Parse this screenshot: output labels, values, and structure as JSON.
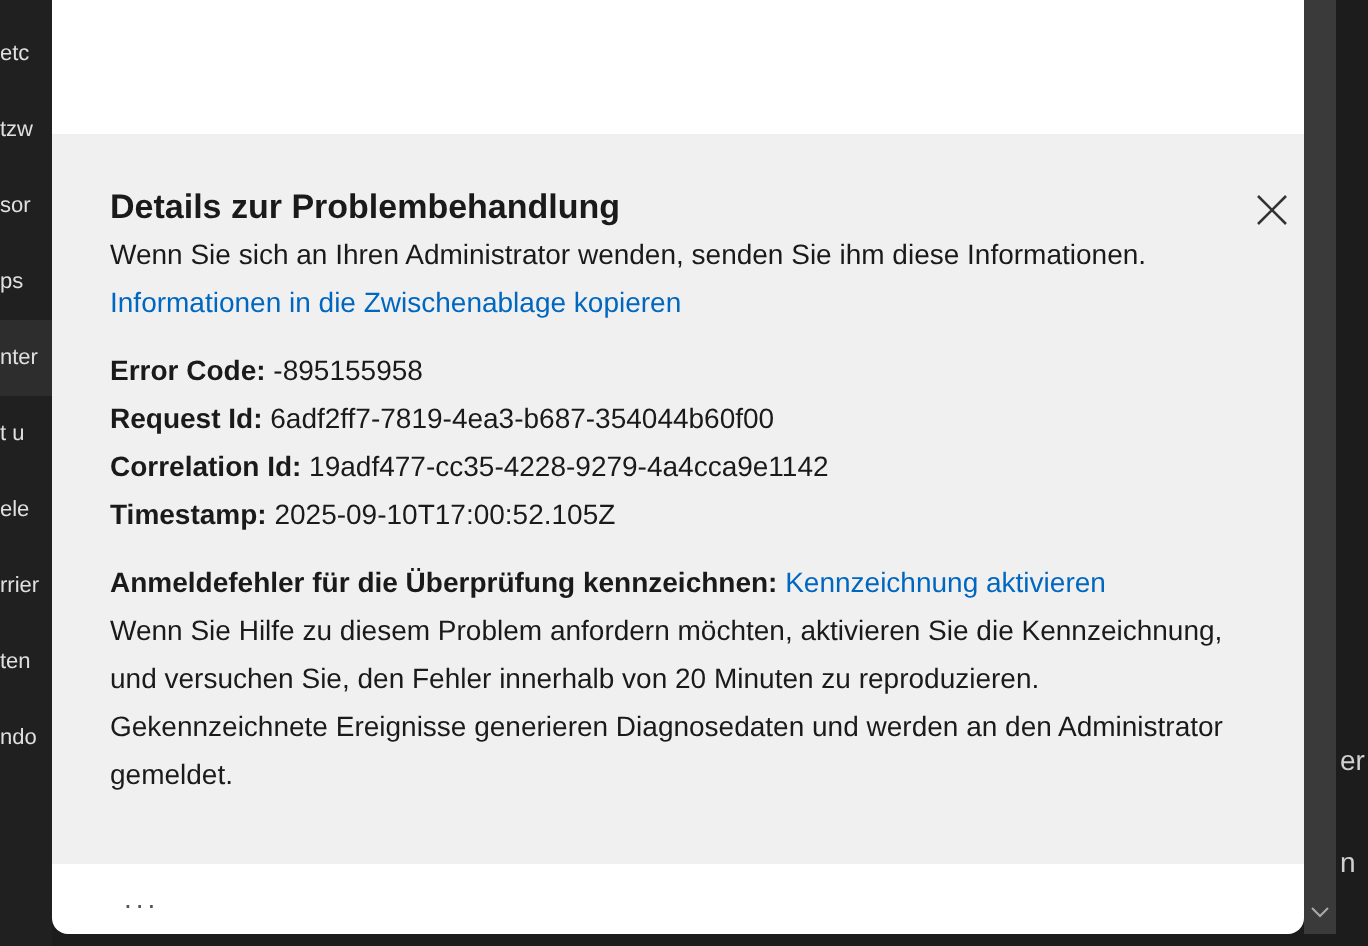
{
  "sidebar": {
    "items": [
      {
        "label": "etc",
        "selected": false
      },
      {
        "label": "tzw",
        "selected": false
      },
      {
        "label": "sor",
        "selected": false
      },
      {
        "label": "ps",
        "selected": false
      },
      {
        "label": "nter",
        "selected": true
      },
      {
        "label": "t u",
        "selected": false
      },
      {
        "label": "ele",
        "selected": false
      },
      {
        "label": "rrier",
        "selected": false
      },
      {
        "label": "ten",
        "selected": false
      },
      {
        "label": "ndo",
        "selected": false
      }
    ]
  },
  "dialog": {
    "title": "Details zur Problembehandlung",
    "subtitle": "Wenn Sie sich an Ihren Administrator wenden, senden Sie ihm diese Informationen.",
    "copy_link": "Informationen in die Zwischenablage kopieren",
    "details": [
      "**Error Code:** -895155958",
      "**Request Id:** 6adf2ff7-7819-4ea3-b687-354044b60f00",
      "**Correlation Id:** 19adf477-cc35-4228-9279-4a4cca9e1142",
      "**Timestamp:** 2025-09-10T17:00:52.105Z"
    ],
    "flag_label": "**Anmeldefehler für die Überprüfung kennzeichnen:** ",
    "flag_link": "Kennzeichnung aktivieren",
    "flag_text": "Wenn Sie Hilfe zu diesem Problem anfordern möchten, aktivieren Sie die Kennzeichnung, und versuchen Sie, den Fehler innerhalb von 20 Minuten zu reproduzieren. Gekennzeichnete Ereignisse generieren Diagnosedaten und werden an den Administrator gemeldet.",
    "more": "..."
  },
  "background_fragments": [
    "er",
    "n"
  ]
}
